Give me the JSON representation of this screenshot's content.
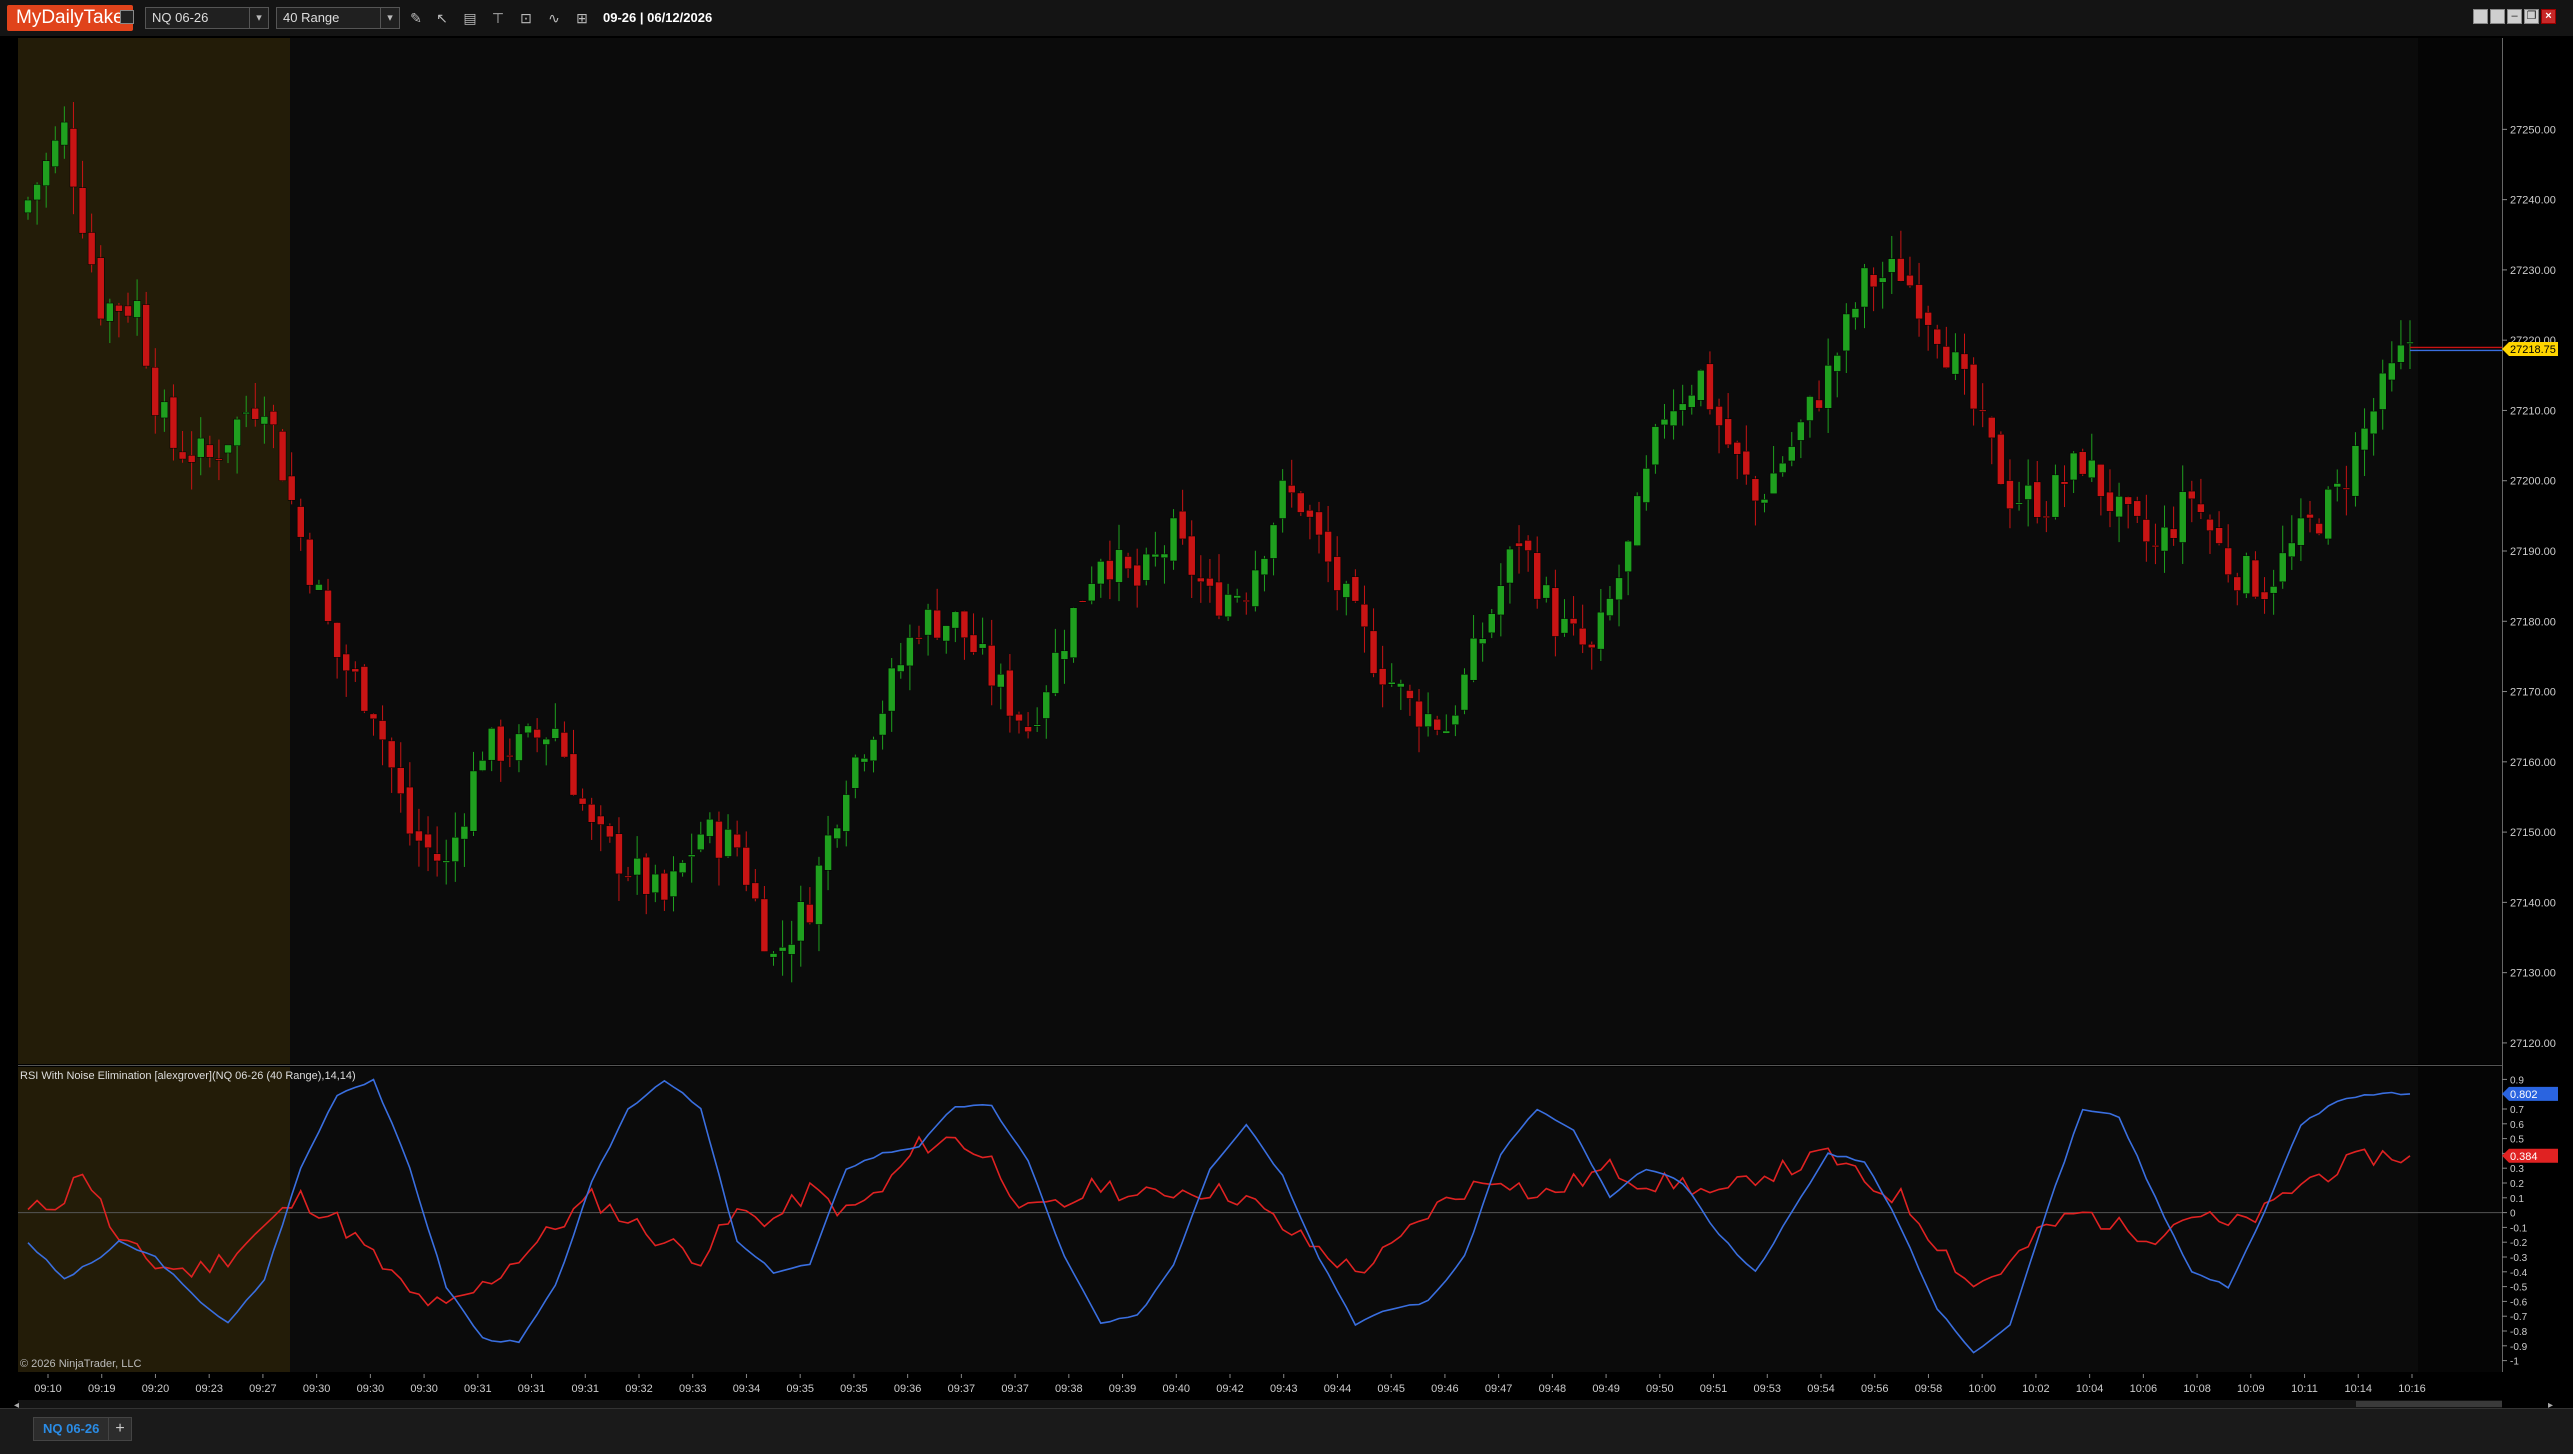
{
  "app": {
    "brand": "MyDailyTake"
  },
  "toolbar": {
    "instrument": "NQ 06-26",
    "bar_type": "40 Range",
    "date_label": "09-26 | 06/12/2026",
    "tools": [
      "pencil-icon",
      "pointer-icon",
      "data-box-icon",
      "drawing-tools-icon",
      "zoom-icon",
      "indicators-icon",
      "strategies-icon"
    ]
  },
  "window_controls": [
    "tile-icon",
    "tile-icon",
    "minimize-icon",
    "restore-icon",
    "close-icon"
  ],
  "price_panel": {
    "y_ticks": [
      "27250.00",
      "27240.00",
      "27230.00",
      "27220.00",
      "27210.00",
      "27200.00",
      "27190.00",
      "27180.00",
      "27170.00",
      "27160.00",
      "27150.00",
      "27140.00",
      "27130.00",
      "27120.00"
    ],
    "last_price": "27218.75",
    "last_price_value": 27218.75,
    "price_range": [
      27117,
      27263
    ],
    "colors": {
      "up": "#1fa01f",
      "down": "#c81414",
      "session_shade": "#231c08",
      "last_price_badge": "#ffd500"
    }
  },
  "indicator_panel": {
    "title": "RSI With Noise Elimination [alexgrover](NQ 06-26 (40 Range),14,14)",
    "y_ticks": [
      "0.9",
      "0.8",
      "0.7",
      "0.6",
      "0.5",
      "0.4",
      "0.3",
      "0.2",
      "0.1",
      "0",
      "-0.1",
      "-0.2",
      "-0.3",
      "-0.4",
      "-0.5",
      "-0.6",
      "-0.7",
      "-0.8",
      "-0.9",
      "-1"
    ],
    "blue_value": "0.802",
    "red_value": "0.384",
    "blue_value_num": 0.802,
    "red_value_num": 0.384,
    "colors": {
      "blue": "#3a6fe0",
      "red": "#e02222"
    }
  },
  "time_axis": {
    "labels": [
      "09:10",
      "09:19",
      "09:20",
      "09:23",
      "09:27",
      "09:30",
      "09:30",
      "09:30",
      "09:31",
      "09:31",
      "09:31",
      "09:32",
      "09:33",
      "09:34",
      "09:35",
      "09:35",
      "09:36",
      "09:37",
      "09:37",
      "09:38",
      "09:39",
      "09:40",
      "09:42",
      "09:43",
      "09:44",
      "09:45",
      "09:46",
      "09:47",
      "09:48",
      "09:49",
      "09:50",
      "09:51",
      "09:53",
      "09:54",
      "09:56",
      "09:58",
      "10:00",
      "10:02",
      "10:04",
      "10:06",
      "10:08",
      "10:09",
      "10:11",
      "10:14",
      "10:16"
    ]
  },
  "copyright": "© 2026 NinjaTrader, LLC",
  "tabs": {
    "active": "NQ 06-26",
    "add": "+"
  },
  "chart_data": [
    {
      "type": "candlestick",
      "title": "",
      "ylim": [
        27117,
        27263
      ],
      "x": [
        "09:10",
        "09:19",
        "09:20",
        "09:23",
        "09:27",
        "09:30",
        "09:31",
        "09:32",
        "09:33",
        "09:34",
        "09:35",
        "09:36",
        "09:37",
        "09:38",
        "09:39",
        "09:40",
        "09:42",
        "09:43",
        "09:44",
        "09:45",
        "09:46",
        "09:47",
        "09:48",
        "09:49",
        "09:50",
        "09:51",
        "09:53",
        "09:54",
        "09:56",
        "09:58",
        "10:00",
        "10:02",
        "10:04",
        "10:06",
        "10:08",
        "10:09",
        "10:11",
        "10:14",
        "10:16"
      ],
      "close_path": [
        [
          0,
          27240
        ],
        [
          4,
          27250
        ],
        [
          8,
          27225
        ],
        [
          12,
          27225
        ],
        [
          14,
          27212
        ],
        [
          16,
          27205
        ],
        [
          20,
          27203
        ],
        [
          24,
          27210
        ],
        [
          26,
          27212
        ],
        [
          30,
          27192
        ],
        [
          34,
          27175
        ],
        [
          38,
          27168
        ],
        [
          42,
          27150
        ],
        [
          46,
          27145
        ],
        [
          50,
          27162
        ],
        [
          54,
          27162
        ],
        [
          58,
          27165
        ],
        [
          62,
          27150
        ],
        [
          66,
          27145
        ],
        [
          70,
          27140
        ],
        [
          74,
          27150
        ],
        [
          78,
          27148
        ],
        [
          82,
          27132
        ],
        [
          86,
          27140
        ],
        [
          90,
          27158
        ],
        [
          94,
          27168
        ],
        [
          98,
          27180
        ],
        [
          102,
          27180
        ],
        [
          106,
          27172
        ],
        [
          110,
          27165
        ],
        [
          114,
          27178
        ],
        [
          118,
          27190
        ],
        [
          122,
          27185
        ],
        [
          126,
          27192
        ],
        [
          130,
          27183
        ],
        [
          134,
          27185
        ],
        [
          138,
          27198
        ],
        [
          140,
          27197
        ],
        [
          144,
          27185
        ],
        [
          148,
          27175
        ],
        [
          152,
          27168
        ],
        [
          156,
          27165
        ],
        [
          160,
          27178
        ],
        [
          164,
          27192
        ],
        [
          168,
          27180
        ],
        [
          172,
          27175
        ],
        [
          176,
          27190
        ],
        [
          180,
          27210
        ],
        [
          184,
          27215
        ],
        [
          186,
          27208
        ],
        [
          190,
          27197
        ],
        [
          194,
          27205
        ],
        [
          198,
          27215
        ],
        [
          202,
          27228
        ],
        [
          206,
          27230
        ],
        [
          210,
          27222
        ],
        [
          214,
          27210
        ],
        [
          218,
          27198
        ],
        [
          222,
          27197
        ],
        [
          226,
          27203
        ],
        [
          230,
          27195
        ],
        [
          234,
          27190
        ],
        [
          238,
          27198
        ],
        [
          242,
          27188
        ],
        [
          246,
          27185
        ],
        [
          250,
          27192
        ],
        [
          254,
          27198
        ],
        [
          258,
          27210
        ],
        [
          262,
          27220
        ]
      ],
      "last": 27218.75
    },
    {
      "type": "line",
      "title": "RSI With Noise Elimination [alexgrover](NQ 06-26 (40 Range),14,14)",
      "ylim": [
        -1.05,
        0.95
      ],
      "series": [
        {
          "name": "",
          "color": "#3a6fe0",
          "points": [
            [
              0,
              -0.2
            ],
            [
              4,
              -0.45
            ],
            [
              8,
              -0.3
            ],
            [
              10,
              -0.2
            ],
            [
              14,
              -0.3
            ],
            [
              18,
              -0.55
            ],
            [
              22,
              -0.75
            ],
            [
              26,
              -0.45
            ],
            [
              30,
              0.3
            ],
            [
              34,
              0.8
            ],
            [
              38,
              0.9
            ],
            [
              42,
              0.3
            ],
            [
              46,
              -0.5
            ],
            [
              50,
              -0.85
            ],
            [
              54,
              -0.88
            ],
            [
              58,
              -0.5
            ],
            [
              62,
              0.2
            ],
            [
              66,
              0.7
            ],
            [
              70,
              0.9
            ],
            [
              74,
              0.7
            ],
            [
              78,
              -0.2
            ],
            [
              82,
              -0.4
            ],
            [
              86,
              -0.35
            ],
            [
              90,
              0.3
            ],
            [
              94,
              0.4
            ],
            [
              98,
              0.45
            ],
            [
              102,
              0.72
            ],
            [
              106,
              0.72
            ],
            [
              110,
              0.35
            ],
            [
              114,
              -0.3
            ],
            [
              118,
              -0.75
            ],
            [
              122,
              -0.7
            ],
            [
              126,
              -0.35
            ],
            [
              130,
              0.3
            ],
            [
              134,
              0.6
            ],
            [
              138,
              0.25
            ],
            [
              142,
              -0.3
            ],
            [
              146,
              -0.75
            ],
            [
              150,
              -0.65
            ],
            [
              154,
              -0.6
            ],
            [
              158,
              -0.3
            ],
            [
              162,
              0.4
            ],
            [
              166,
              0.7
            ],
            [
              170,
              0.55
            ],
            [
              174,
              0.1
            ],
            [
              178,
              0.3
            ],
            [
              182,
              0.2
            ],
            [
              186,
              -0.15
            ],
            [
              190,
              -0.4
            ],
            [
              194,
              0.0
            ],
            [
              198,
              0.4
            ],
            [
              202,
              0.35
            ],
            [
              206,
              -0.1
            ],
            [
              210,
              -0.65
            ],
            [
              214,
              -0.95
            ],
            [
              218,
              -0.75
            ],
            [
              222,
              0.0
            ],
            [
              226,
              0.7
            ],
            [
              230,
              0.65
            ],
            [
              234,
              0.1
            ],
            [
              238,
              -0.4
            ],
            [
              242,
              -0.5
            ],
            [
              246,
              0.0
            ],
            [
              250,
              0.6
            ],
            [
              254,
              0.75
            ],
            [
              258,
              0.802
            ]
          ]
        },
        {
          "name": "",
          "color": "#e02222",
          "points": [
            [
              0,
              0.0
            ],
            [
              4,
              0.1
            ],
            [
              6,
              0.3
            ],
            [
              10,
              -0.2
            ],
            [
              14,
              -0.35
            ],
            [
              18,
              -0.4
            ],
            [
              22,
              -0.3
            ],
            [
              26,
              -0.1
            ],
            [
              30,
              0.1
            ],
            [
              34,
              -0.05
            ],
            [
              38,
              -0.3
            ],
            [
              42,
              -0.55
            ],
            [
              46,
              -0.65
            ],
            [
              50,
              -0.5
            ],
            [
              54,
              -0.3
            ],
            [
              58,
              -0.1
            ],
            [
              62,
              0.1
            ],
            [
              66,
              -0.05
            ],
            [
              70,
              -0.2
            ],
            [
              74,
              -0.3
            ],
            [
              78,
              0.0
            ],
            [
              82,
              -0.05
            ],
            [
              86,
              0.15
            ],
            [
              90,
              0.0
            ],
            [
              94,
              0.15
            ],
            [
              98,
              0.45
            ],
            [
              102,
              0.5
            ],
            [
              106,
              0.35
            ],
            [
              110,
              0.0
            ],
            [
              114,
              0.05
            ],
            [
              118,
              0.2
            ],
            [
              122,
              0.1
            ],
            [
              126,
              0.15
            ],
            [
              130,
              0.15
            ],
            [
              134,
              0.1
            ],
            [
              138,
              -0.1
            ],
            [
              142,
              -0.25
            ],
            [
              146,
              -0.4
            ],
            [
              150,
              -0.25
            ],
            [
              154,
              0.0
            ],
            [
              158,
              0.15
            ],
            [
              162,
              0.25
            ],
            [
              166,
              0.1
            ],
            [
              170,
              0.2
            ],
            [
              174,
              0.3
            ],
            [
              178,
              0.2
            ],
            [
              182,
              0.2
            ],
            [
              186,
              0.1
            ],
            [
              190,
              0.25
            ],
            [
              194,
              0.3
            ],
            [
              198,
              0.4
            ],
            [
              202,
              0.2
            ],
            [
              206,
              0.1
            ],
            [
              210,
              -0.2
            ],
            [
              214,
              -0.5
            ],
            [
              218,
              -0.35
            ],
            [
              222,
              -0.1
            ],
            [
              226,
              0.0
            ],
            [
              230,
              -0.1
            ],
            [
              234,
              -0.15
            ],
            [
              238,
              0.0
            ],
            [
              242,
              -0.1
            ],
            [
              246,
              0.0
            ],
            [
              250,
              0.2
            ],
            [
              254,
              0.3
            ],
            [
              258,
              0.384
            ]
          ]
        }
      ]
    }
  ]
}
